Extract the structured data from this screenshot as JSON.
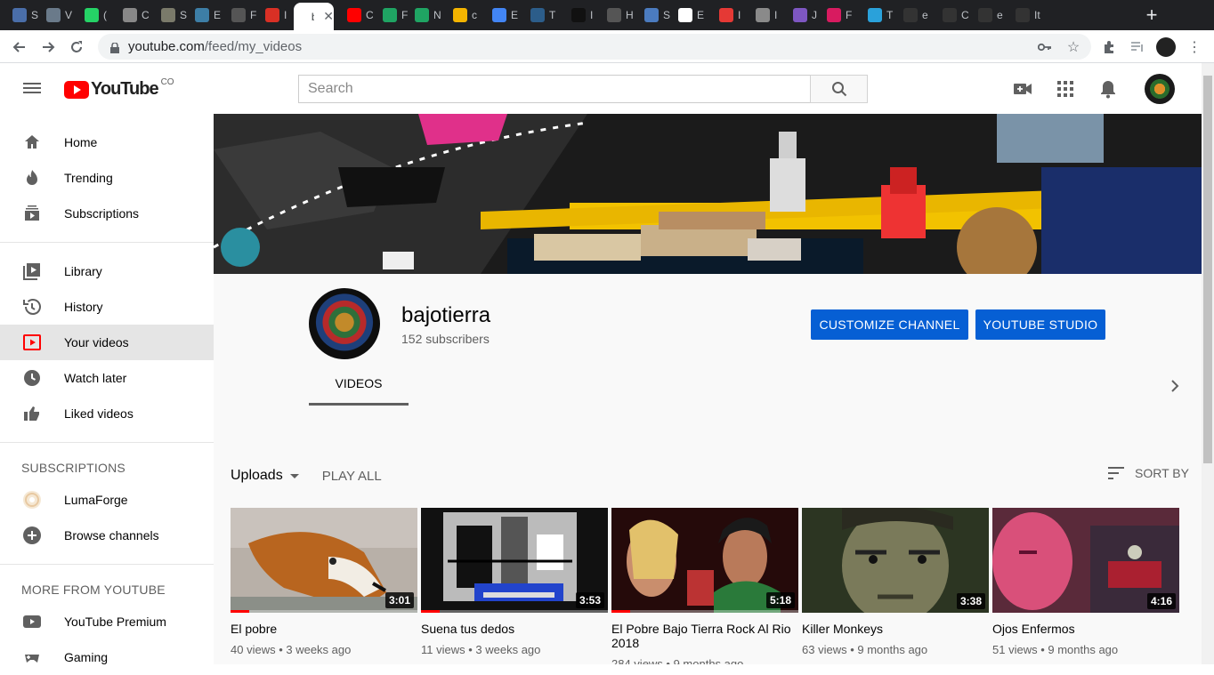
{
  "browser": {
    "tabs": [
      {
        "label": "S",
        "color": "#4a6ea9"
      },
      {
        "label": "V",
        "color": "#6a7a8a"
      },
      {
        "label": "(",
        "color": "#25d366"
      },
      {
        "label": "C",
        "color": "#888888"
      },
      {
        "label": "S",
        "color": "#7a7a6a"
      },
      {
        "label": "E",
        "color": "#3d7ea6"
      },
      {
        "label": "F",
        "color": "#555555"
      },
      {
        "label": "I",
        "color": "#d93025"
      },
      {
        "label": "b",
        "color": "#ffffff"
      },
      {
        "label": "C",
        "color": "#ff0000"
      },
      {
        "label": "F",
        "color": "#1fa463"
      },
      {
        "label": "N",
        "color": "#1fa463"
      },
      {
        "label": "c",
        "color": "#f4b400"
      },
      {
        "label": "E",
        "color": "#4285f4"
      },
      {
        "label": "T",
        "color": "#2c5d8a"
      },
      {
        "label": "I",
        "color": "#111111"
      },
      {
        "label": "H",
        "color": "#555555"
      },
      {
        "label": "S",
        "color": "#4b7bbf"
      },
      {
        "label": "E",
        "color": "#ffffff"
      },
      {
        "label": "I",
        "color": "#e53935"
      },
      {
        "label": "I",
        "color": "#8a8a8a"
      },
      {
        "label": "J",
        "color": "#7e57c2"
      },
      {
        "label": "F",
        "color": "#d81b60"
      },
      {
        "label": "T",
        "color": "#2aa1da"
      },
      {
        "label": "e",
        "color": "#333333"
      },
      {
        "label": "C",
        "color": "#333333"
      },
      {
        "label": "e",
        "color": "#333333"
      },
      {
        "label": "It",
        "color": "#333333"
      }
    ],
    "active_tab_label": "b",
    "url_host": "youtube.com",
    "url_path": "/feed/my_videos"
  },
  "masthead": {
    "logo_text": "YouTube",
    "country_code": "CO",
    "search_placeholder": "Search"
  },
  "sidebar": {
    "primary": [
      {
        "label": "Home",
        "icon": "home-icon"
      },
      {
        "label": "Trending",
        "icon": "trending-icon"
      },
      {
        "label": "Subscriptions",
        "icon": "subscriptions-icon"
      }
    ],
    "library": [
      {
        "label": "Library",
        "icon": "library-icon"
      },
      {
        "label": "History",
        "icon": "history-icon"
      },
      {
        "label": "Your videos",
        "icon": "your-videos-icon",
        "active": true
      },
      {
        "label": "Watch later",
        "icon": "watch-later-icon"
      },
      {
        "label": "Liked videos",
        "icon": "liked-videos-icon"
      }
    ],
    "subscriptions_heading": "SUBSCRIPTIONS",
    "subscriptions": [
      {
        "label": "LumaForge",
        "icon": "channel-avatar"
      },
      {
        "label": "Browse channels",
        "icon": "add-circle-icon"
      }
    ],
    "more_heading": "MORE FROM YOUTUBE",
    "more": [
      {
        "label": "YouTube Premium",
        "icon": "youtube-premium-icon"
      },
      {
        "label": "Gaming",
        "icon": "gaming-icon"
      }
    ]
  },
  "channel": {
    "name": "bajotierra",
    "subscribers": "152 subscribers",
    "customize_label": "CUSTOMIZE CHANNEL",
    "studio_label": "YOUTUBE STUDIO",
    "tab_videos": "VIDEOS",
    "uploads_label": "Uploads",
    "play_all_label": "PLAY ALL",
    "sort_label": "SORT BY"
  },
  "videos": [
    {
      "title": "El pobre",
      "meta": "40 views • 3 weeks ago",
      "duration": "3:01",
      "progress": 0.1,
      "thumb": "dog"
    },
    {
      "title": "Suena tus dedos",
      "meta": "11 views • 3 weeks ago",
      "duration": "3:53",
      "progress": 0.1,
      "thumb": "glitch"
    },
    {
      "title": "El Pobre Bajo Tierra Rock Al Rio 2018",
      "meta": "284 views • 9 months ago",
      "duration": "5:18",
      "progress": 0.1,
      "thumb": "crowd"
    },
    {
      "title": "Killer Monkeys",
      "meta": "63 views • 9 months ago",
      "duration": "3:38",
      "progress": 0,
      "thumb": "face"
    },
    {
      "title": "Ojos Enfermos",
      "meta": "51 views • 9 months ago",
      "duration": "4:16",
      "progress": 0,
      "thumb": "pink"
    }
  ]
}
